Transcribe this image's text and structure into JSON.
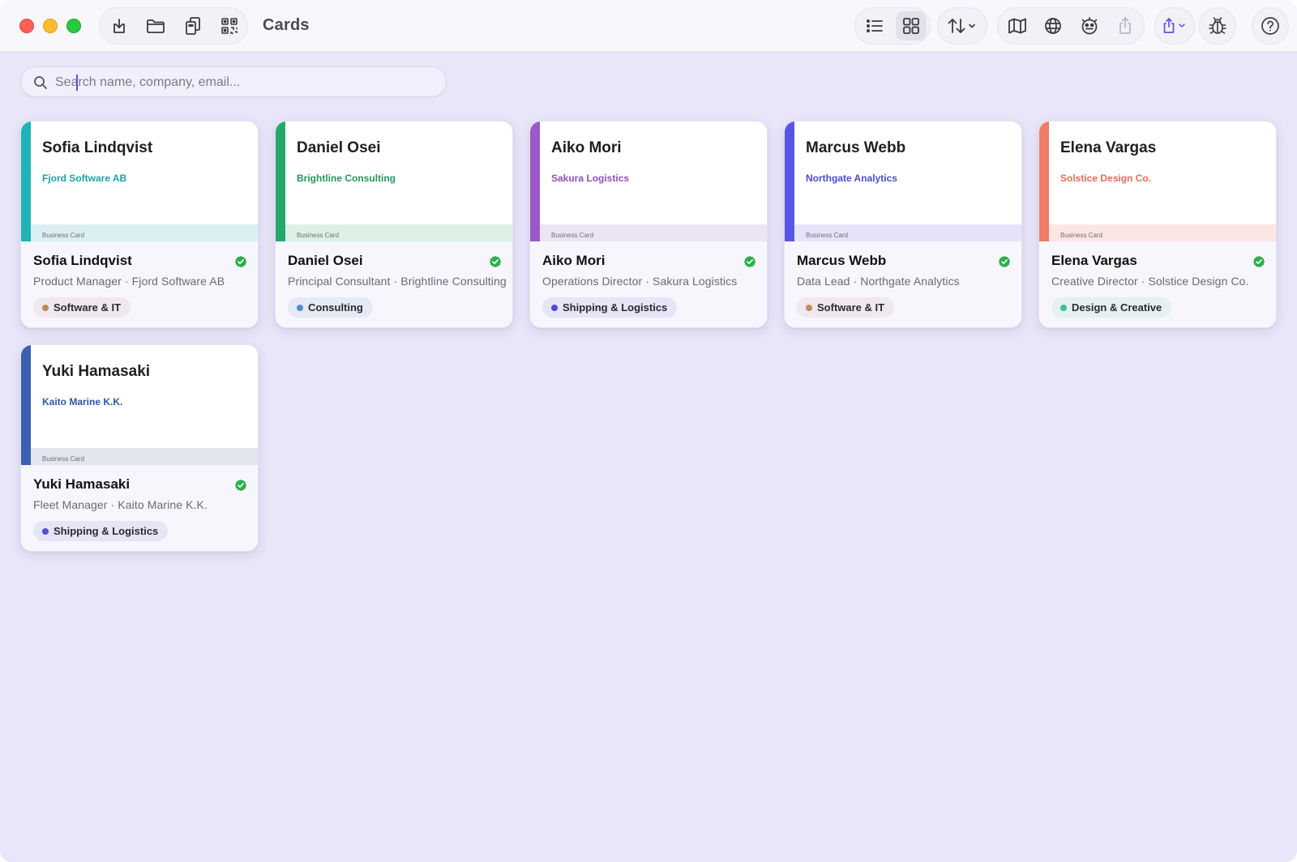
{
  "window": {
    "title": "Cards",
    "background": "#e8e6f8"
  },
  "toolbar": {
    "left_icons": [
      "import-icon",
      "folder-icon",
      "copy-cards-icon",
      "qr-code-icon"
    ],
    "view_icons": [
      "list-view-icon",
      "grid-view-icon"
    ],
    "sort_icon": "sort-arrows-icon",
    "right_icons": [
      "map-icon",
      "globe-icon",
      "stats-face-icon",
      "share-icon"
    ],
    "export_icon": "export-menu-icon",
    "debug_icon": "bug-icon",
    "help_icon": "help-icon",
    "active_view": "grid"
  },
  "search": {
    "placeholder": "Search name, company, email...",
    "value": ""
  },
  "cards": [
    {
      "front_name": "Sofia Lindqvist",
      "front_company": "Fjord Software AB",
      "label": "Business Card",
      "name": "Sofia Lindqvist",
      "role": "Product Manager · Fjord Software AB",
      "tag": "Software & IT",
      "accent": "#1fb3b5",
      "band": "#dbeff3",
      "company_color": "#1aa3a8",
      "tag_bg": "#efe9ee",
      "tag_dot": "#c08a5a",
      "verified": true
    },
    {
      "front_name": "Daniel Osei",
      "front_company": "Brightline Consulting",
      "label": "Business Card",
      "name": "Daniel Osei",
      "role": "Principal Consultant · Brightline Consulting",
      "tag": "Consulting",
      "accent": "#26a86a",
      "band": "#dcf0e6",
      "company_color": "#1f9a5e",
      "tag_bg": "#e6eaf6",
      "tag_dot": "#4a90d9",
      "verified": true
    },
    {
      "front_name": "Aiko Mori",
      "front_company": "Sakura Logistics",
      "label": "Business Card",
      "name": "Aiko Mori",
      "role": "Operations Director · Sakura Logistics",
      "tag": "Shipping & Logistics",
      "accent": "#9b59c7",
      "band": "#ece4f4",
      "company_color": "#8e4fbf",
      "tag_bg": "#e6e5f8",
      "tag_dot": "#4f4fd0",
      "verified": true
    },
    {
      "front_name": "Marcus Webb",
      "front_company": "Northgate Analytics",
      "label": "Business Card",
      "name": "Marcus Webb",
      "role": "Data Lead · Northgate Analytics",
      "tag": "Software & IT",
      "accent": "#5a54e6",
      "band": "#e4e3f8",
      "company_color": "#4f49d8",
      "tag_bg": "#efe9ee",
      "tag_dot": "#c08a5a",
      "verified": true
    },
    {
      "front_name": "Elena Vargas",
      "front_company": "Solstice Design Co.",
      "label": "Business Card",
      "name": "Elena Vargas",
      "role": "Creative Director · Solstice Design Co.",
      "tag": "Design & Creative",
      "accent": "#f07c68",
      "band": "#fbe6e4",
      "company_color": "#ec6a55",
      "tag_bg": "#e4f1ef",
      "tag_dot": "#3cbf9c",
      "verified": true
    },
    {
      "front_name": "Yuki Hamasaki",
      "front_company": "Kaito Marine K.K.",
      "label": "Business Card",
      "name": "Yuki Hamasaki",
      "role": "Fleet Manager · Kaito Marine K.K.",
      "tag": "Shipping & Logistics",
      "accent": "#3a5fb3",
      "band": "#e2e5ee",
      "company_color": "#2f55a8",
      "tag_bg": "#e6e5f8",
      "tag_dot": "#4f4fd0",
      "verified": true
    }
  ]
}
